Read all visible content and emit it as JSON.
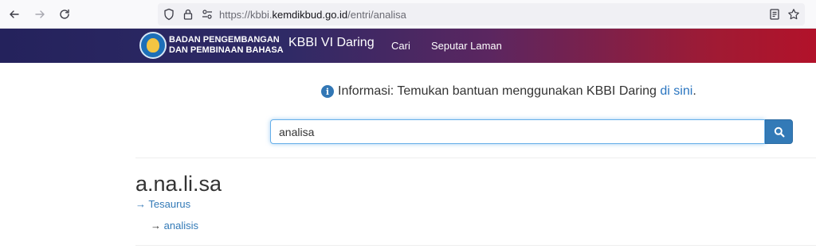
{
  "browser": {
    "url_prefix": "https://kbbi.",
    "url_domain": "kemdikbud.go.id",
    "url_path": "/entri/analisa"
  },
  "header": {
    "brand_line1": "BADAN PENGEMBANGAN",
    "brand_line2": "DAN PEMBINAAN BAHASA",
    "title": "KBBI VI Daring",
    "nav": {
      "search": "Cari",
      "about": "Seputar Laman"
    }
  },
  "info": {
    "text": "Informasi: Temukan bantuan menggunakan KBBI Daring ",
    "link": "di sini",
    "end": "."
  },
  "search": {
    "value": "analisa"
  },
  "entry": {
    "headword": "a.na.li.sa",
    "thesaurus_arrow": "→",
    "thesaurus_label": "Tesaurus",
    "ref_arrow": "→",
    "ref_word": "analisis"
  }
}
